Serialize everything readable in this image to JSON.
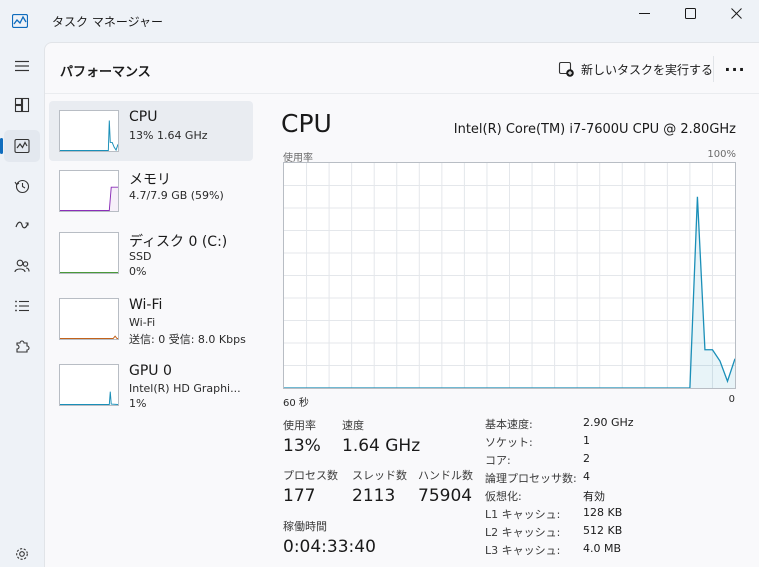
{
  "window": {
    "title": "タスク マネージャー"
  },
  "header": {
    "page_title": "パフォーマンス",
    "run_task_label": "新しいタスクを実行する",
    "more_label": "···"
  },
  "nav": {
    "items": [
      "processes",
      "performance",
      "app-history",
      "startup",
      "users",
      "details",
      "services"
    ],
    "active": "performance"
  },
  "resources": [
    {
      "id": "cpu",
      "name": "CPU",
      "lines": [
        "13%  1.64 GHz"
      ],
      "color": "#1a8fb8",
      "selected": true
    },
    {
      "id": "memory",
      "name": "メモリ",
      "lines": [
        "4.7/7.9 GB (59%)"
      ],
      "color": "#8b2fb8",
      "selected": false
    },
    {
      "id": "disk",
      "name": "ディスク 0 (C:)",
      "lines": [
        "SSD",
        "0%"
      ],
      "color": "#4a9a3a",
      "selected": false
    },
    {
      "id": "wifi",
      "name": "Wi-Fi",
      "lines": [
        "Wi-Fi",
        "送信: 0 受信: 8.0 Kbps"
      ],
      "color": "#c2621b",
      "selected": false
    },
    {
      "id": "gpu",
      "name": "GPU 0",
      "lines": [
        "Intel(R) HD Graphi...",
        "1%"
      ],
      "color": "#1a8fb8",
      "selected": false
    }
  ],
  "detail": {
    "title": "CPU",
    "model": "Intel(R) Core(TM) i7-7600U CPU @ 2.80GHz",
    "graph_label_left": "使用率",
    "graph_label_right": "100%",
    "axis_left": "60 秒",
    "axis_right": "0",
    "line_color": "#1a8fb8"
  },
  "chart_data": {
    "type": "area",
    "x": [
      0,
      2,
      4,
      6,
      8,
      10,
      12,
      14,
      16,
      18,
      20,
      22,
      24,
      26,
      28,
      30,
      32,
      34,
      36,
      38,
      40,
      42,
      44,
      46,
      48,
      50,
      51,
      52,
      53,
      54,
      55,
      56,
      57,
      58,
      59,
      60
    ],
    "y": [
      0,
      0,
      0,
      0,
      0,
      0,
      0,
      0,
      0,
      0,
      0,
      0,
      0,
      0,
      0,
      0,
      0,
      0,
      0,
      0,
      0,
      0,
      0,
      0,
      0,
      0,
      0,
      0,
      0,
      0,
      85,
      17,
      17,
      12,
      3,
      13
    ],
    "ylim": [
      0,
      100
    ],
    "grid": true
  },
  "stats": {
    "usage_label": "使用率",
    "usage_value": "13%",
    "speed_label": "速度",
    "speed_value": "1.64 GHz",
    "processes_label": "プロセス数",
    "processes_value": "177",
    "threads_label": "スレッド数",
    "threads_value": "2113",
    "handles_label": "ハンドル数",
    "handles_value": "75904",
    "uptime_label": "稼働時間",
    "uptime_value": "0:04:33:40"
  },
  "info": [
    {
      "label": "基本速度:",
      "value": "2.90 GHz"
    },
    {
      "label": "ソケット:",
      "value": "1"
    },
    {
      "label": "コア:",
      "value": "2"
    },
    {
      "label": "論理プロセッサ数:",
      "value": "4"
    },
    {
      "label": "仮想化:",
      "value": "有効"
    },
    {
      "label": "L1 キャッシュ:",
      "value": "128 KB"
    },
    {
      "label": "L2 キャッシュ:",
      "value": "512 KB"
    },
    {
      "label": "L3 キャッシュ:",
      "value": "4.0 MB"
    }
  ]
}
